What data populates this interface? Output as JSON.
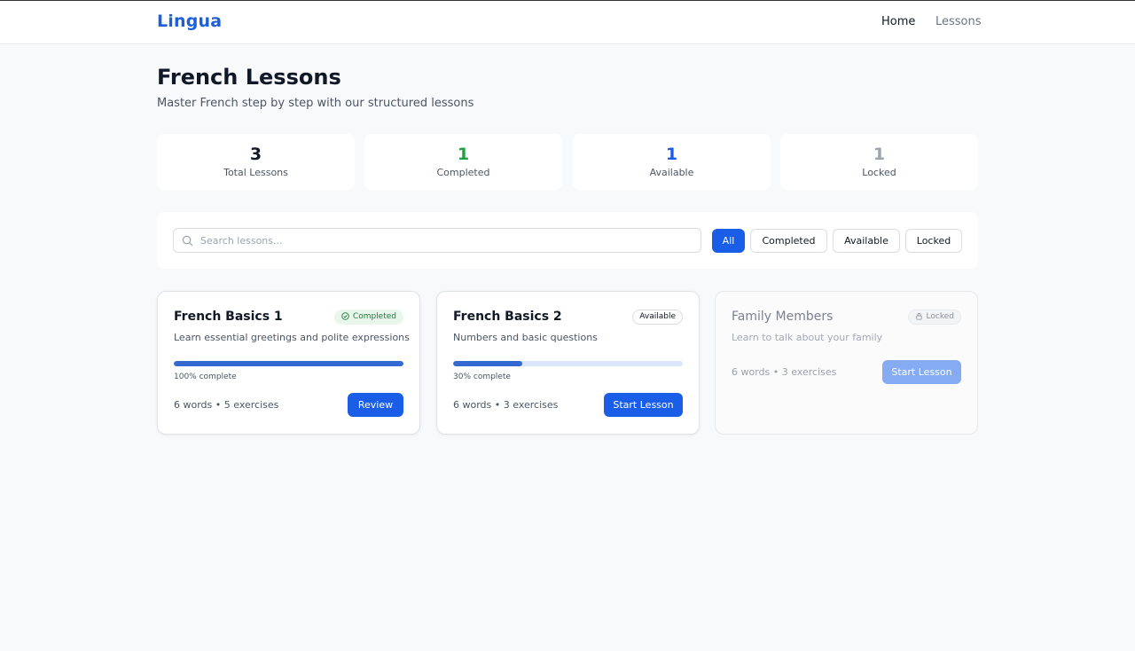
{
  "header": {
    "logo": "Lingua",
    "nav": [
      {
        "label": "Home",
        "active": true
      },
      {
        "label": "Lessons",
        "active": false
      }
    ]
  },
  "page": {
    "title": "French Lessons",
    "subtitle": "Master French step by step with our structured lessons"
  },
  "stats": [
    {
      "value": "3",
      "label": "Total Lessons",
      "color": "#111827"
    },
    {
      "value": "1",
      "label": "Completed",
      "color": "#22a045"
    },
    {
      "value": "1",
      "label": "Available",
      "color": "#1a5ee8"
    },
    {
      "value": "1",
      "label": "Locked",
      "color": "#9ca3af"
    }
  ],
  "search": {
    "placeholder": "Search lessons...",
    "value": ""
  },
  "filters": [
    {
      "label": "All",
      "active": true
    },
    {
      "label": "Completed",
      "active": false
    },
    {
      "label": "Available",
      "active": false
    },
    {
      "label": "Locked",
      "active": false
    }
  ],
  "lessons": [
    {
      "title": "French Basics 1",
      "description": "Learn essential greetings and polite expressions",
      "status": "Completed",
      "progress": 100,
      "progress_label": "100% complete",
      "meta": "6 words • 5 exercises",
      "action": "Review"
    },
    {
      "title": "French Basics 2",
      "description": "Numbers and basic questions",
      "status": "Available",
      "progress": 30,
      "progress_label": "30% complete",
      "meta": "6 words • 3 exercises",
      "action": "Start Lesson"
    },
    {
      "title": "Family Members",
      "description": "Learn to talk about your family",
      "status": "Locked",
      "meta": "6 words • 3 exercises",
      "action": "Start Lesson"
    }
  ],
  "colors": {
    "brand": "#1d5fd6",
    "primary_button": "#1a5ee8",
    "progress": "#3569d2",
    "completed_badge_bg": "#e8f6ec",
    "completed_badge_text": "#1f7a3a"
  }
}
